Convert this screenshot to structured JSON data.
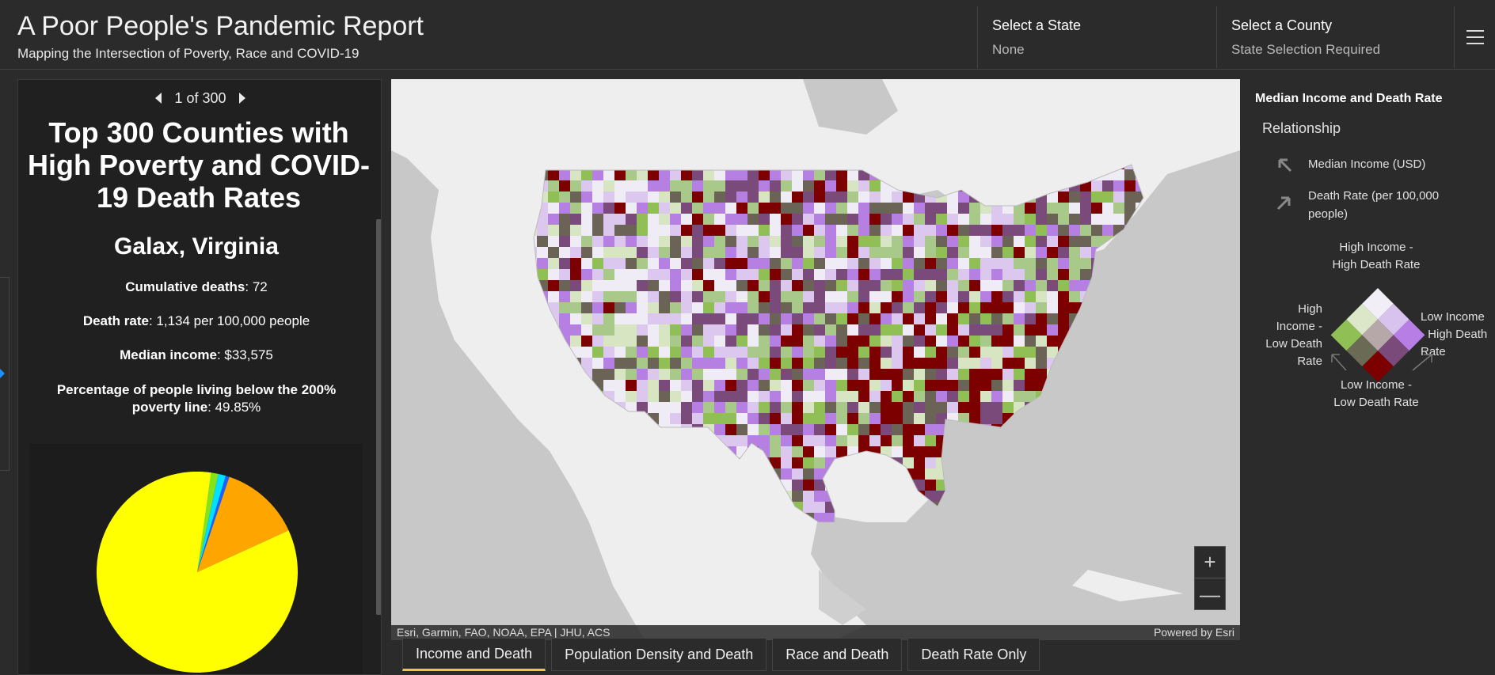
{
  "header": {
    "title": "A Poor People's Pandemic Report",
    "subtitle": "Mapping the Intersection of Poverty, Race and COVID-19",
    "state_label": "Select a State",
    "state_value": "None",
    "county_label": "Select a County",
    "county_value": "State Selection Required",
    "menu_icon": "hamburger-menu-icon"
  },
  "panel": {
    "pager": "1 of 300",
    "heading": "Top 300 Counties with High Poverty and COVID-19 Death Rates",
    "county": "Galax, Virginia",
    "stats": [
      {
        "label": "Cumulative deaths",
        "value": ": 72"
      },
      {
        "label": "Death rate",
        "value": ": 1,134 per 100,000 people"
      },
      {
        "label": "Median income",
        "value": ": $33,575"
      },
      {
        "label": "Percentage of people living below the 200% poverty line",
        "value": ": 49.85%"
      }
    ],
    "pie": {
      "slices": [
        {
          "value": 0.84,
          "color": "#ffff00"
        },
        {
          "value": 0.13,
          "color": "#ffa500"
        },
        {
          "value": 0.045,
          "color": "#84e31c"
        },
        {
          "value": 0.012,
          "color": "#00e0ff"
        },
        {
          "value": 0.006,
          "color": "#1e5fff"
        }
      ]
    }
  },
  "map": {
    "attribution_left": "Esri, Garmin, FAO, NOAA, EPA | JHU, ACS",
    "attribution_right": "Powered by Esri",
    "zoom_in": "+",
    "zoom_out": "—"
  },
  "legend": {
    "title": "Median Income and Death Rate",
    "relationship": "Relationship",
    "income_axis": "Median Income (USD)",
    "death_axis": "Death Rate (per 100,000 people)",
    "top_label": "High Income - High Death Rate",
    "left_label": "High Income - Low Death Rate",
    "right_label": "Low Income - High Death Rate",
    "bottom_label": "Low Income - Low Death Rate",
    "colors": [
      "#f2eef8",
      "#d8c3ee",
      "#b77fe6",
      "#dbe7c8",
      "#b6a8a8",
      "#7a4a7a",
      "#8fbf55",
      "#6b6b55",
      "#7d0000"
    ]
  },
  "tabs": [
    {
      "label": "Income and Death",
      "active": true
    },
    {
      "label": "Population Density and Death",
      "active": false
    },
    {
      "label": "Race and Death",
      "active": false
    },
    {
      "label": "Death Rate Only",
      "active": false
    }
  ]
}
